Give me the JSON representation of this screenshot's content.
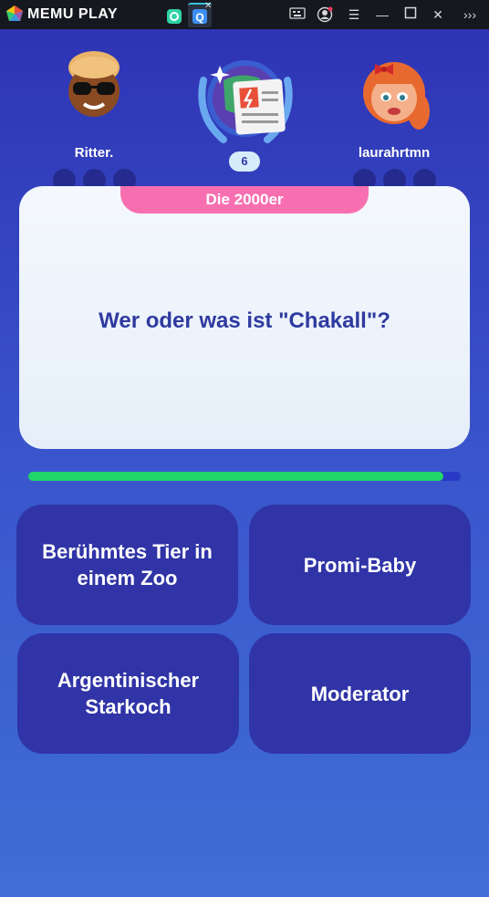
{
  "window": {
    "brand": "MEMU PLAY",
    "icons": [
      "memu-logo-icon",
      "app-tab-icon",
      "quiz-tab-icon",
      "keyboard-mapping-icon",
      "account-icon",
      "menu-icon",
      "minimize-icon",
      "maximize-icon",
      "close-icon",
      "more-icon"
    ]
  },
  "players": {
    "left": {
      "name": "Ritter."
    },
    "right": {
      "name": "laurahrtmn"
    }
  },
  "round": "6",
  "question": {
    "category": "Die 2000er",
    "text": "Wer oder was ist \"Chakall\"?"
  },
  "timer": {
    "progress": 0.96,
    "fill_color": "#22d56a"
  },
  "answers": [
    "Berühmtes Tier in einem Zoo",
    "Promi-Baby",
    "Argentinischer Starkoch",
    "Moderator"
  ],
  "colors": {
    "category_bg": "#f76fb0",
    "answer_bg": "#3034a6",
    "question_text": "#2f3aa0"
  }
}
